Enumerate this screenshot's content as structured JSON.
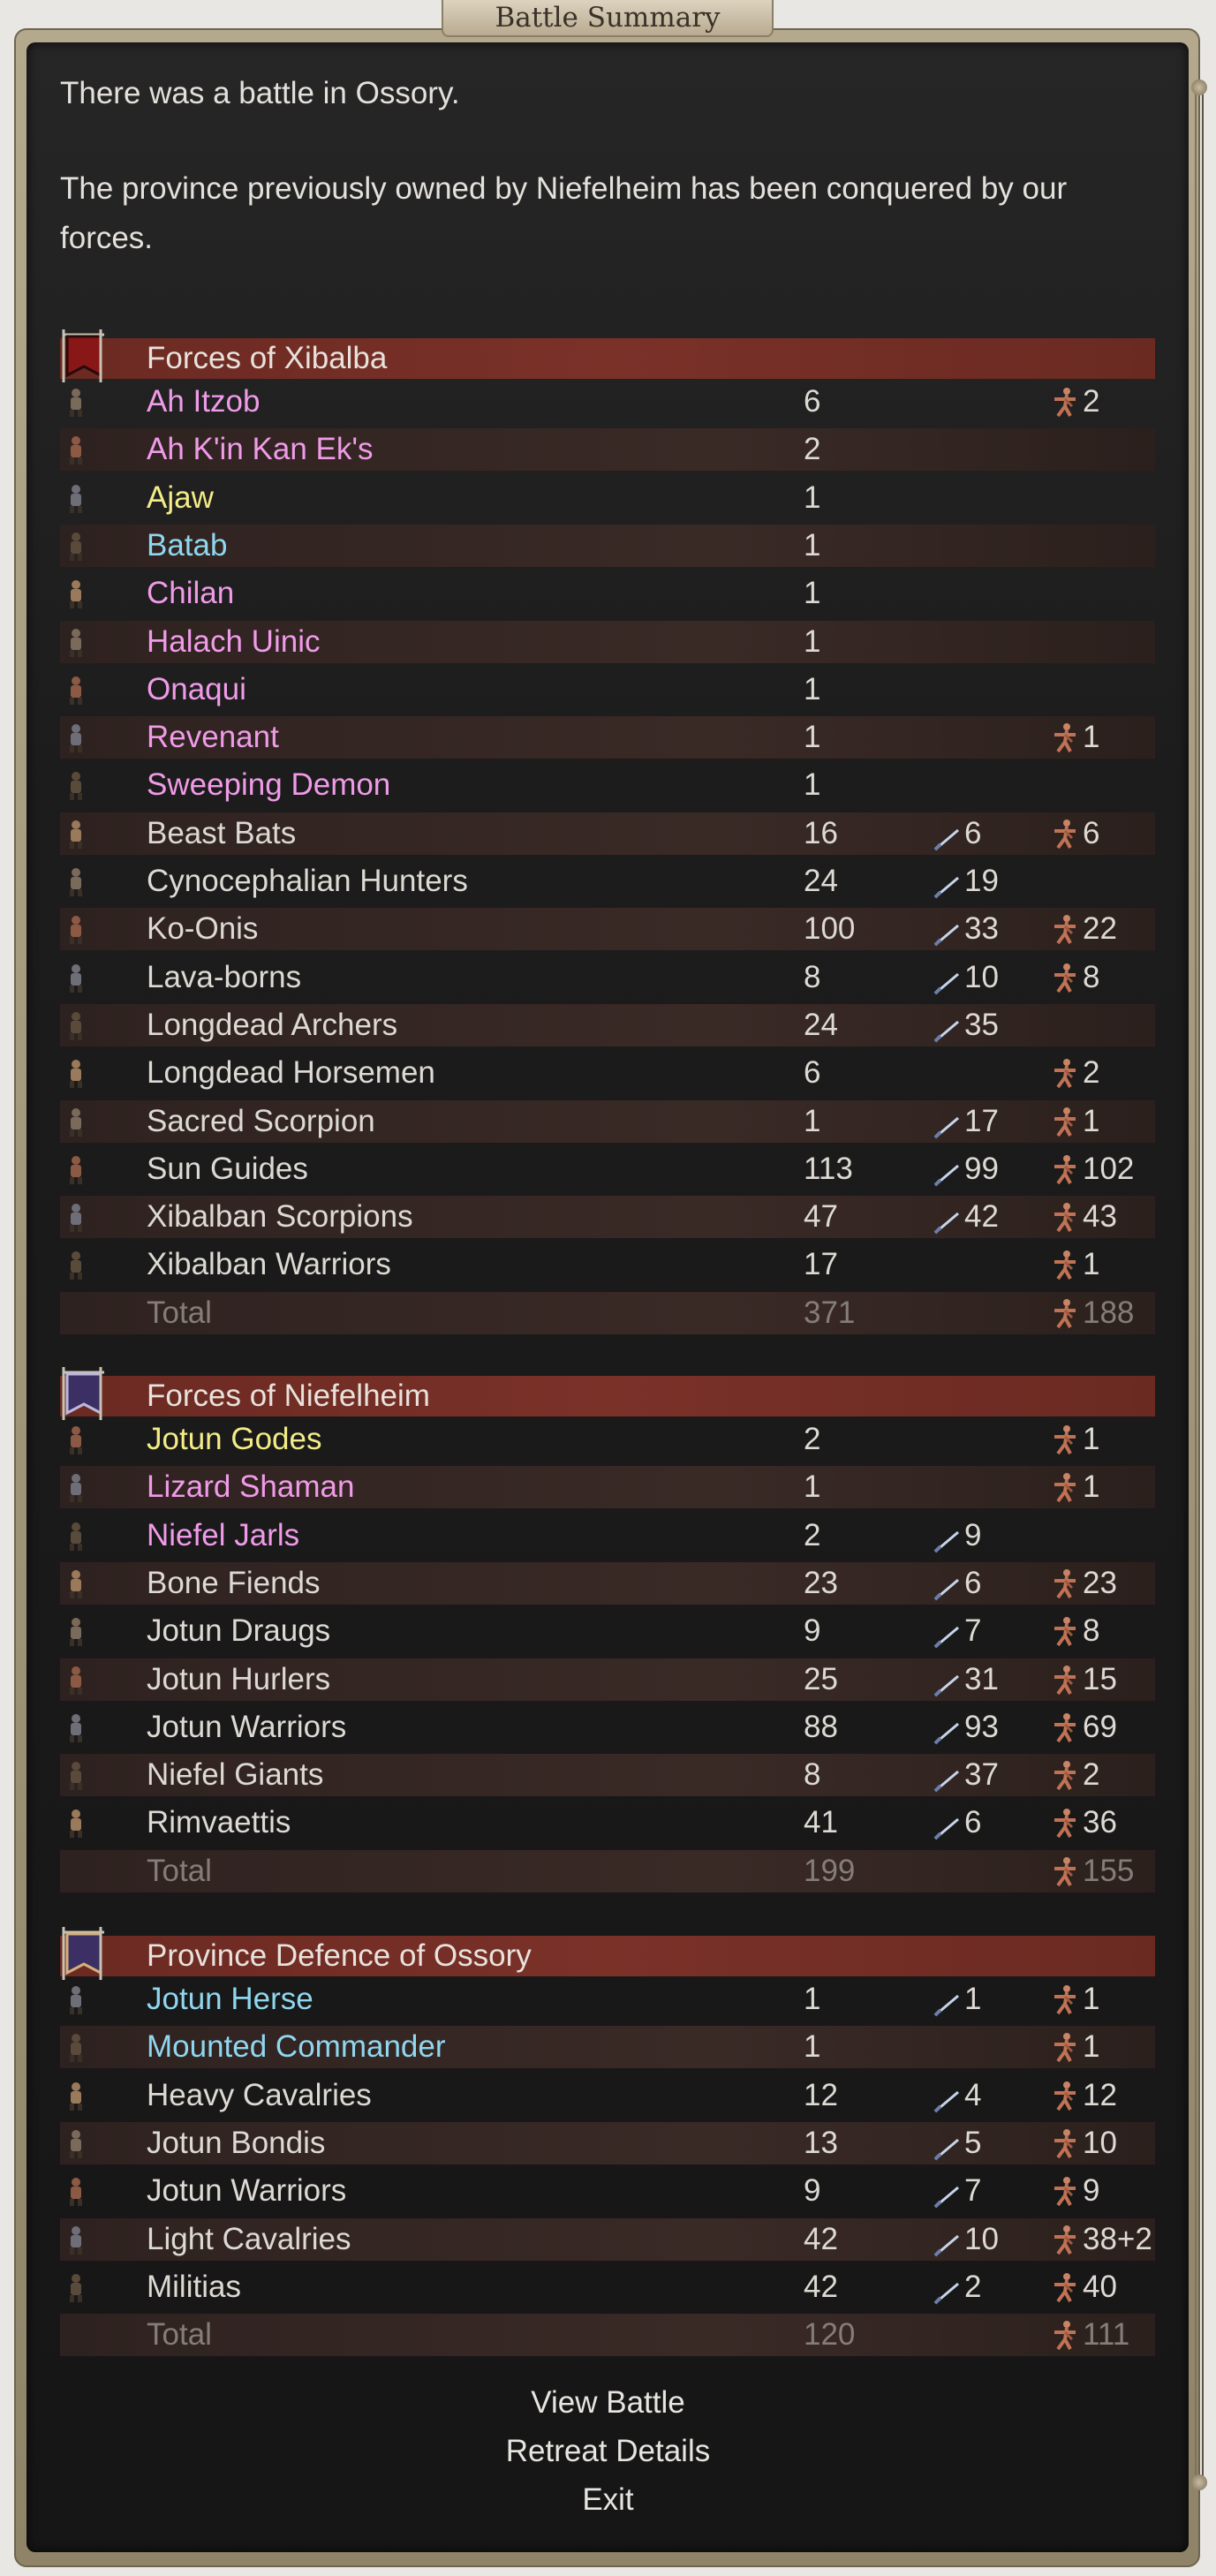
{
  "window": {
    "title": "Battle Summary"
  },
  "messages": [
    "There was a battle in Ossory.",
    "The province previously owned by Niefelheim has been conquered by our",
    "forces."
  ],
  "colors": {
    "pink": "#f09be8",
    "yellow": "#f3ec87",
    "cyan": "#8fd7ef",
    "header": "#6b2a22"
  },
  "icons": {
    "kills": "sword-icon",
    "losses": "fallen-soldier-icon"
  },
  "sections": [
    {
      "title": "Forces of Xibalba",
      "banner": "xibalba-banner-icon",
      "units": [
        {
          "name": "Ah Itzob",
          "color": "pink",
          "count": "6",
          "kills": "",
          "losses": "2"
        },
        {
          "name": "Ah K'in Kan Ek's",
          "color": "pink",
          "count": "2",
          "kills": "",
          "losses": ""
        },
        {
          "name": "Ajaw",
          "color": "yellow",
          "count": "1",
          "kills": "",
          "losses": ""
        },
        {
          "name": "Batab",
          "color": "cyan",
          "count": "1",
          "kills": "",
          "losses": ""
        },
        {
          "name": "Chilan",
          "color": "pink",
          "count": "1",
          "kills": "",
          "losses": ""
        },
        {
          "name": "Halach Uinic",
          "color": "pink",
          "count": "1",
          "kills": "",
          "losses": ""
        },
        {
          "name": "Onaqui",
          "color": "pink",
          "count": "1",
          "kills": "",
          "losses": ""
        },
        {
          "name": "Revenant",
          "color": "pink",
          "count": "1",
          "kills": "",
          "losses": "1"
        },
        {
          "name": "Sweeping Demon",
          "color": "pink",
          "count": "1",
          "kills": "",
          "losses": ""
        },
        {
          "name": "Beast Bats",
          "color": "",
          "count": "16",
          "kills": "6",
          "losses": "6"
        },
        {
          "name": "Cynocephalian Hunters",
          "color": "",
          "count": "24",
          "kills": "19",
          "losses": ""
        },
        {
          "name": "Ko-Onis",
          "color": "",
          "count": "100",
          "kills": "33",
          "losses": "22"
        },
        {
          "name": "Lava-borns",
          "color": "",
          "count": "8",
          "kills": "10",
          "losses": "8"
        },
        {
          "name": "Longdead Archers",
          "color": "",
          "count": "24",
          "kills": "35",
          "losses": ""
        },
        {
          "name": "Longdead Horsemen",
          "color": "",
          "count": "6",
          "kills": "",
          "losses": "2"
        },
        {
          "name": "Sacred Scorpion",
          "color": "",
          "count": "1",
          "kills": "17",
          "losses": "1"
        },
        {
          "name": "Sun Guides",
          "color": "",
          "count": "113",
          "kills": "99",
          "losses": "102"
        },
        {
          "name": "Xibalban Scorpions",
          "color": "",
          "count": "47",
          "kills": "42",
          "losses": "43"
        },
        {
          "name": "Xibalban Warriors",
          "color": "",
          "count": "17",
          "kills": "",
          "losses": "1"
        }
      ],
      "total": {
        "label": "Total",
        "count": "371",
        "losses": "188"
      }
    },
    {
      "title": "Forces of Niefelheim",
      "banner": "niefelheim-banner-icon",
      "units": [
        {
          "name": "Jotun Godes",
          "color": "yellow",
          "count": "2",
          "kills": "",
          "losses": "1"
        },
        {
          "name": "Lizard Shaman",
          "color": "pink",
          "count": "1",
          "kills": "",
          "losses": "1"
        },
        {
          "name": "Niefel Jarls",
          "color": "pink",
          "count": "2",
          "kills": "9",
          "losses": ""
        },
        {
          "name": "Bone Fiends",
          "color": "",
          "count": "23",
          "kills": "6",
          "losses": "23"
        },
        {
          "name": "Jotun Draugs",
          "color": "",
          "count": "9",
          "kills": "7",
          "losses": "8"
        },
        {
          "name": "Jotun Hurlers",
          "color": "",
          "count": "25",
          "kills": "31",
          "losses": "15"
        },
        {
          "name": "Jotun Warriors",
          "color": "",
          "count": "88",
          "kills": "93",
          "losses": "69"
        },
        {
          "name": "Niefel Giants",
          "color": "",
          "count": "8",
          "kills": "37",
          "losses": "2"
        },
        {
          "name": "Rimvaettis",
          "color": "",
          "count": "41",
          "kills": "6",
          "losses": "36"
        }
      ],
      "total": {
        "label": "Total",
        "count": "199",
        "losses": "155"
      }
    },
    {
      "title": "Province Defence of Ossory",
      "banner": "province-banner-icon",
      "units": [
        {
          "name": "Jotun Herse",
          "color": "cyan",
          "count": "1",
          "kills": "1",
          "losses": "1"
        },
        {
          "name": "Mounted Commander",
          "color": "cyan",
          "count": "1",
          "kills": "",
          "losses": "1"
        },
        {
          "name": "Heavy Cavalries",
          "color": "",
          "count": "12",
          "kills": "4",
          "losses": "12"
        },
        {
          "name": "Jotun Bondis",
          "color": "",
          "count": "13",
          "kills": "5",
          "losses": "10"
        },
        {
          "name": "Jotun Warriors",
          "color": "",
          "count": "9",
          "kills": "7",
          "losses": "9"
        },
        {
          "name": "Light Cavalries",
          "color": "",
          "count": "42",
          "kills": "10",
          "losses": "38+2"
        },
        {
          "name": "Militias",
          "color": "",
          "count": "42",
          "kills": "2",
          "losses": "40"
        }
      ],
      "total": {
        "label": "Total",
        "count": "120",
        "losses": "111"
      }
    }
  ],
  "buttons": {
    "view_battle": "View Battle",
    "retreat_details": "Retreat Details",
    "exit": "Exit"
  }
}
